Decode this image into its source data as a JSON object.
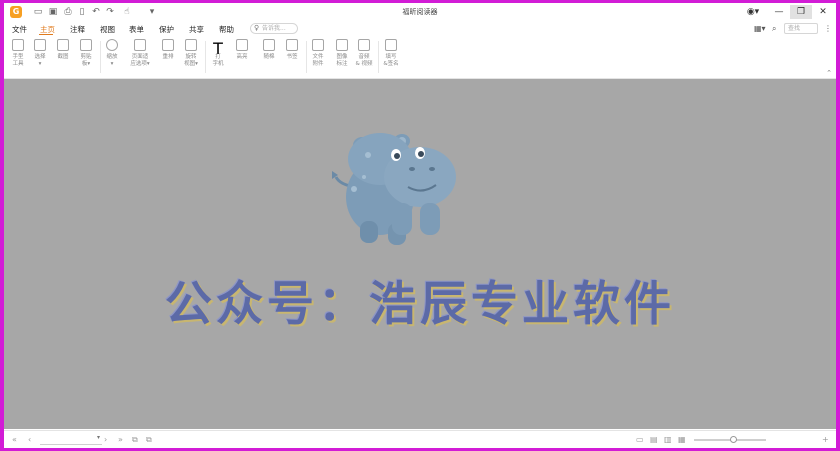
{
  "window": {
    "title": "福昕阅读器"
  },
  "titlebar": {
    "logo_letter": "G",
    "quick_icons": [
      "folder-icon",
      "save-icon",
      "print-icon",
      "new-doc-icon",
      "undo-icon",
      "redo-icon",
      "hand-cursor-icon",
      "customize-dropdown-icon"
    ],
    "window_buttons": [
      "account-icon",
      "minimize-icon",
      "restore-icon",
      "close-icon"
    ]
  },
  "menu": {
    "items": [
      "文件",
      "主页",
      "注释",
      "视图",
      "表单",
      "保护",
      "共享",
      "帮助"
    ],
    "active": "主页",
    "search_placeholder": "告诉我...",
    "find_placeholder": "查找"
  },
  "toolbar": {
    "tools": [
      {
        "label1": "手型",
        "label2": "工具",
        "icon": "hand-icon"
      },
      {
        "label1": "选择",
        "label2": "▾",
        "icon": "select-text-icon"
      },
      {
        "label1": "截图",
        "label2": "",
        "icon": "snapshot-icon"
      },
      {
        "label1": "剪贴",
        "label2": "板▾",
        "icon": "clipboard-icon"
      },
      {
        "label1": "缩放",
        "label2": "▾",
        "icon": "zoom-icon"
      },
      {
        "label1": "页面适",
        "label2": "应选项▾",
        "icon": "fit-page-icon"
      },
      {
        "label1": "重排",
        "label2": "",
        "icon": "reflow-icon"
      },
      {
        "label1": "旋转",
        "label2": "视图▾",
        "icon": "rotate-icon"
      },
      {
        "label1": "打",
        "label2": "字机",
        "icon": "typewriter-icon"
      },
      {
        "label1": "高亮",
        "label2": "",
        "icon": "highlight-icon"
      },
      {
        "label1": "随棉",
        "label2": "",
        "icon": "pencil-icon"
      },
      {
        "label1": "书签",
        "label2": "",
        "icon": "bookmark-icon"
      },
      {
        "label1": "文件",
        "label2": "附件",
        "icon": "attachment-icon"
      },
      {
        "label1": "图像",
        "label2": "标注",
        "icon": "image-annotation-icon"
      },
      {
        "label1": "音频",
        "label2": "& 视频",
        "icon": "audio-video-icon"
      },
      {
        "label1": "填写",
        "label2": "&签名",
        "icon": "fill-sign-icon"
      }
    ]
  },
  "document": {
    "watermark_text": "公众号：浩辰专业软件",
    "image": "hippo-illustration"
  },
  "statusbar": {
    "page_indicator": "▾",
    "zoom_level": 0.55
  }
}
